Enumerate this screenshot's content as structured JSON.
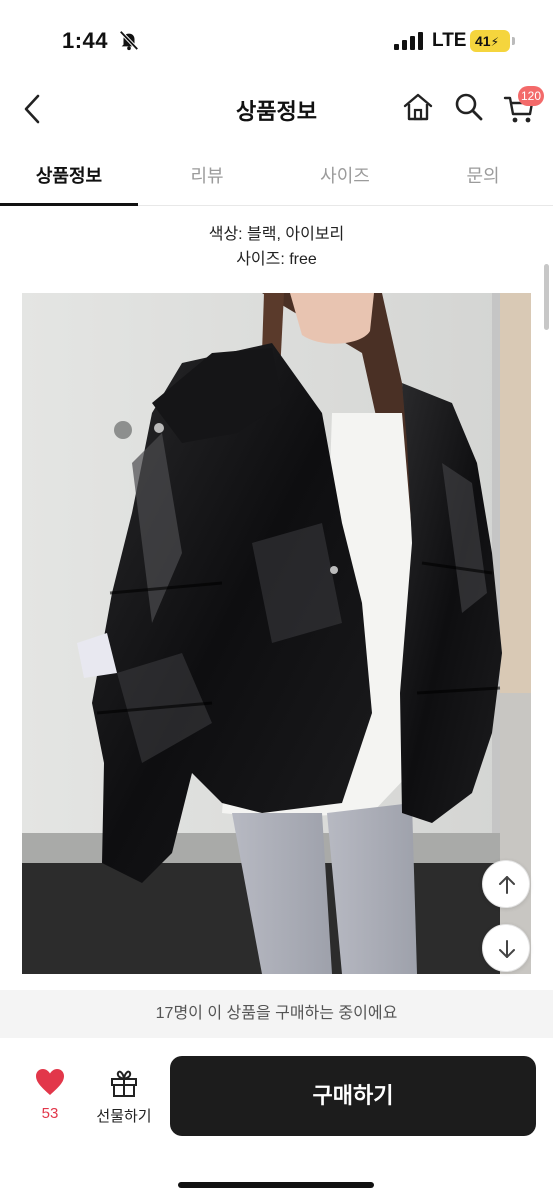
{
  "status_bar": {
    "time": "1:44",
    "network": "LTE",
    "battery": "41"
  },
  "header": {
    "title": "상품정보",
    "cart_badge": "120"
  },
  "tabs": [
    {
      "label": "상품정보",
      "active": true
    },
    {
      "label": "리뷰",
      "active": false
    },
    {
      "label": "사이즈",
      "active": false
    },
    {
      "label": "문의",
      "active": false
    }
  ],
  "description": {
    "color_line": "색상: 블랙, 아이보리",
    "size_line": "사이즈: free"
  },
  "notice": "17명이 이 상품을 구매하는 중이에요",
  "actions": {
    "like_count": "53",
    "gift_label": "선물하기",
    "buy_label": "구매하기"
  },
  "icons": [
    "bell-slash-icon",
    "signal-icon",
    "back-icon",
    "home-icon",
    "search-icon",
    "cart-icon",
    "arrow-up-icon",
    "arrow-down-icon",
    "heart-icon",
    "gift-icon"
  ],
  "colors": {
    "accent_red": "#e2374a",
    "buy_button": "#1c1c1c",
    "badge": "#f36a6a",
    "battery": "#f5d53d"
  }
}
